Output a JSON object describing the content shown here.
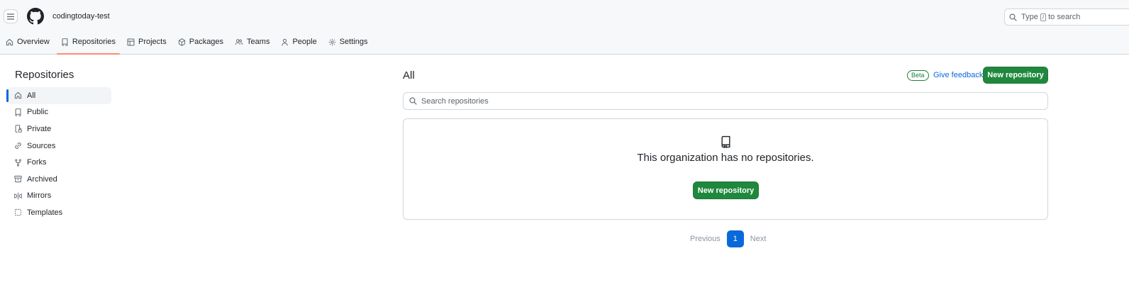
{
  "header": {
    "org_name": "codingtoday-test",
    "search": {
      "prefix": "Type",
      "key": "/",
      "suffix": "to search"
    }
  },
  "nav": {
    "items": [
      {
        "label": "Overview",
        "icon": "home-icon"
      },
      {
        "label": "Repositories",
        "icon": "repo-icon",
        "active": true
      },
      {
        "label": "Projects",
        "icon": "table-icon"
      },
      {
        "label": "Packages",
        "icon": "package-icon"
      },
      {
        "label": "Teams",
        "icon": "people-icon"
      },
      {
        "label": "People",
        "icon": "person-icon"
      },
      {
        "label": "Settings",
        "icon": "gear-icon"
      }
    ]
  },
  "sidebar": {
    "title": "Repositories",
    "items": [
      {
        "label": "All",
        "icon": "home-icon",
        "active": true
      },
      {
        "label": "Public",
        "icon": "repo-icon"
      },
      {
        "label": "Private",
        "icon": "lock-repo-icon"
      },
      {
        "label": "Sources",
        "icon": "link-icon"
      },
      {
        "label": "Forks",
        "icon": "fork-icon"
      },
      {
        "label": "Archived",
        "icon": "archive-icon"
      },
      {
        "label": "Mirrors",
        "icon": "mirror-icon"
      },
      {
        "label": "Templates",
        "icon": "template-icon"
      }
    ]
  },
  "main": {
    "title": "All",
    "beta_label": "Beta",
    "feedback_label": "Give feedback",
    "new_repo_label": "New repository",
    "search_placeholder": "Search repositories",
    "empty": {
      "message": "This organization has no repositories.",
      "button_label": "New repository"
    },
    "pagination": {
      "previous": "Previous",
      "current": "1",
      "next": "Next"
    }
  },
  "colors": {
    "primary_green": "#1f883d",
    "link_blue": "#0969da",
    "active_tab_underline": "#fd8c73"
  }
}
